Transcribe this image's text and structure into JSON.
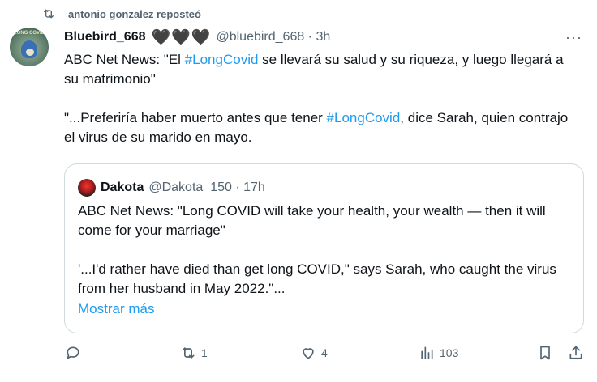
{
  "repost": {
    "text": "antonio gonzalez reposteó",
    "icon": "repost-icon"
  },
  "tweet": {
    "avatar_text": "LONG COVID",
    "name": "Bluebird_668",
    "hearts": "🖤🖤🖤",
    "handle": "@bluebird_668 · 3h",
    "text1_a": "ABC Net News: \"El ",
    "text1_tag": "#LongCovid",
    "text1_b": "  se llevará su salud y su riqueza, y luego llegará a su matrimonio\"",
    "text2_a": "\"...Preferiría haber muerto antes que tener ",
    "text2_tag": "#LongCovid",
    "text2_b": ", dice Sarah, quien contrajo el virus de su marido en mayo."
  },
  "quote": {
    "name": "Dakota",
    "handle": "@Dakota_150 · 17h",
    "para1": "ABC Net News: \"Long COVID will take your health, your wealth — then it will come for your marriage\"",
    "para2": "'...I'd rather have died than get long COVID,\" says Sarah, who caught the virus from her husband in May 2022.\"...",
    "show_more": "Mostrar más"
  },
  "actions": {
    "reply_count": "",
    "repost_count": "1",
    "like_count": "4",
    "views_count": "103"
  },
  "colors": {
    "accent": "#1d9bf0",
    "muted": "#536471",
    "border": "#cfd9de"
  }
}
